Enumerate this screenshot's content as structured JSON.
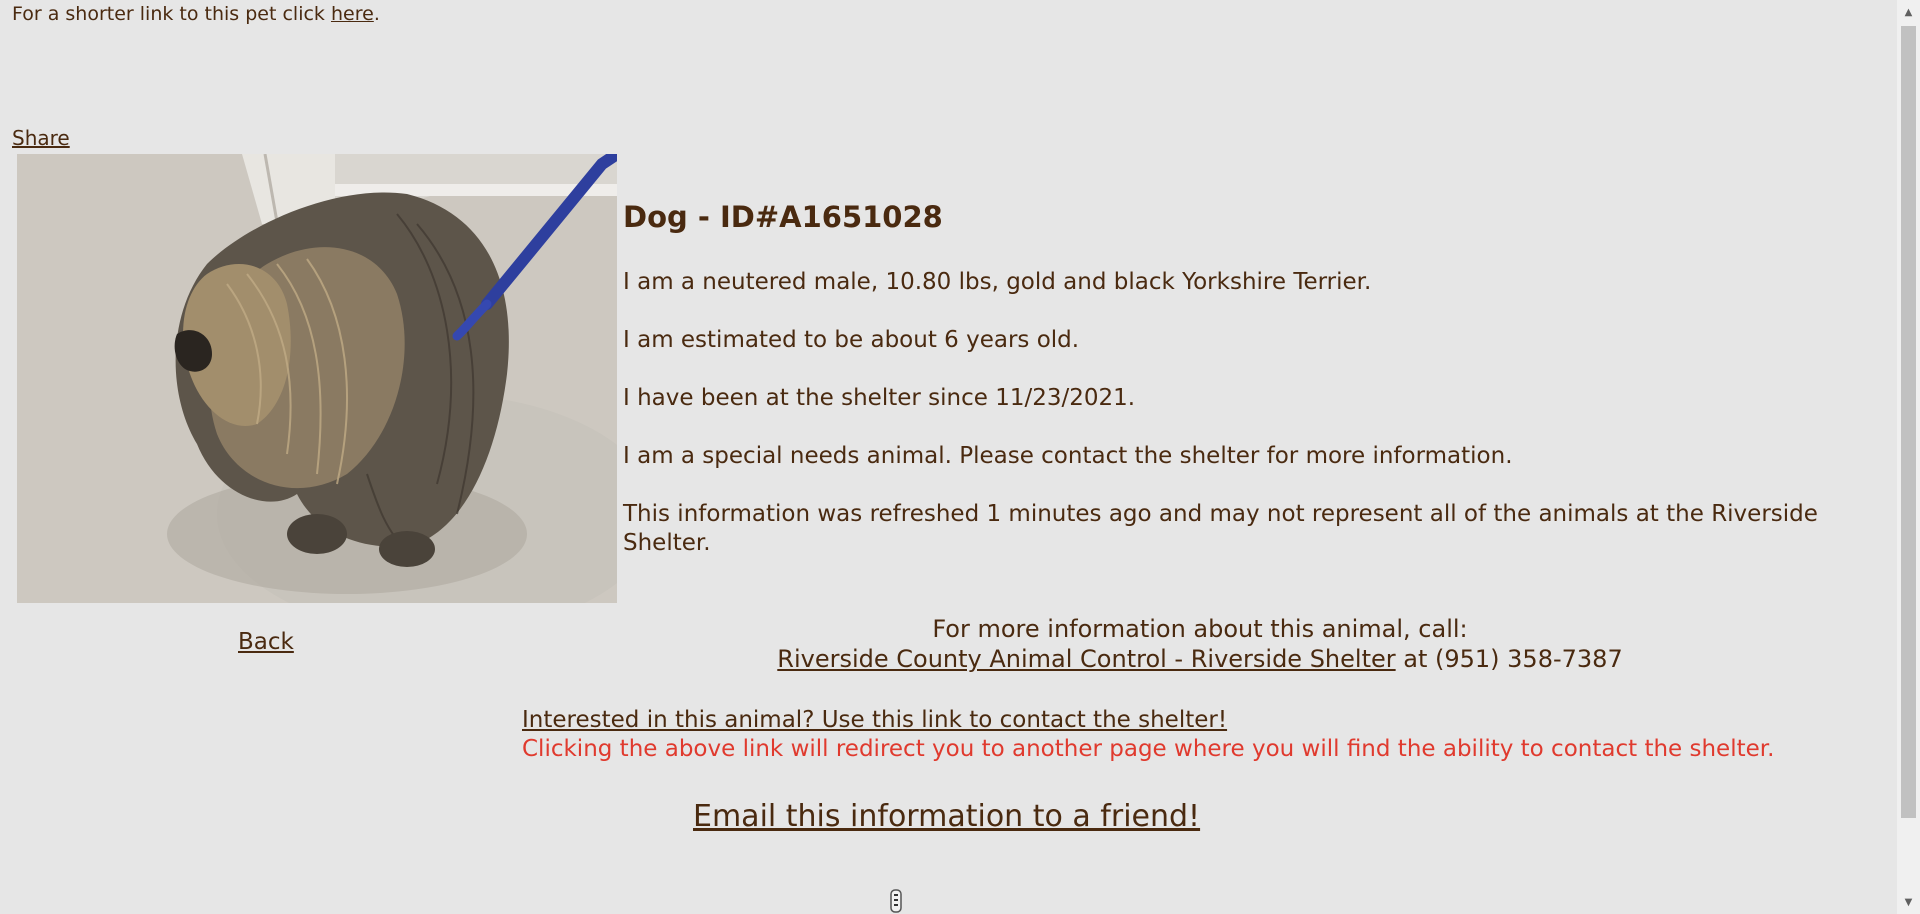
{
  "top": {
    "shortlink_prefix": "For a shorter link to this pet click ",
    "shortlink_link": "here",
    "shortlink_suffix": "."
  },
  "share_label": "Share",
  "photo": {
    "alt": "Photo of a gold and black Yorkshire Terrier on a leash"
  },
  "pet": {
    "title": "Dog - ID#A1651028",
    "description": "I am a neutered male, 10.80 lbs, gold and black Yorkshire Terrier.",
    "age": "I am estimated to be about 6 years old.",
    "since": "I have been at the shelter since 11/23/2021.",
    "special_needs": "I am a special needs animal. Please contact the shelter for more information.",
    "refresh_note": "This information was refreshed 1 minutes ago and may not represent all of the animals at the Riverside Shelter."
  },
  "back_label": "Back",
  "contact": {
    "intro": "For more information about this animal, call:",
    "shelter_link": "Riverside County Animal Control - Riverside Shelter",
    "phone_text": " at (951) 358-7387"
  },
  "interest": {
    "link": "Interested in this animal? Use this link to contact the shelter!",
    "note": "Clicking the above link will redirect you to another page where you will find the ability to contact the shelter."
  },
  "email_label": "Email this information to a friend!",
  "colors": {
    "text": "#4a2a10",
    "warning": "#e03a2e",
    "background": "#e6e6e6"
  }
}
